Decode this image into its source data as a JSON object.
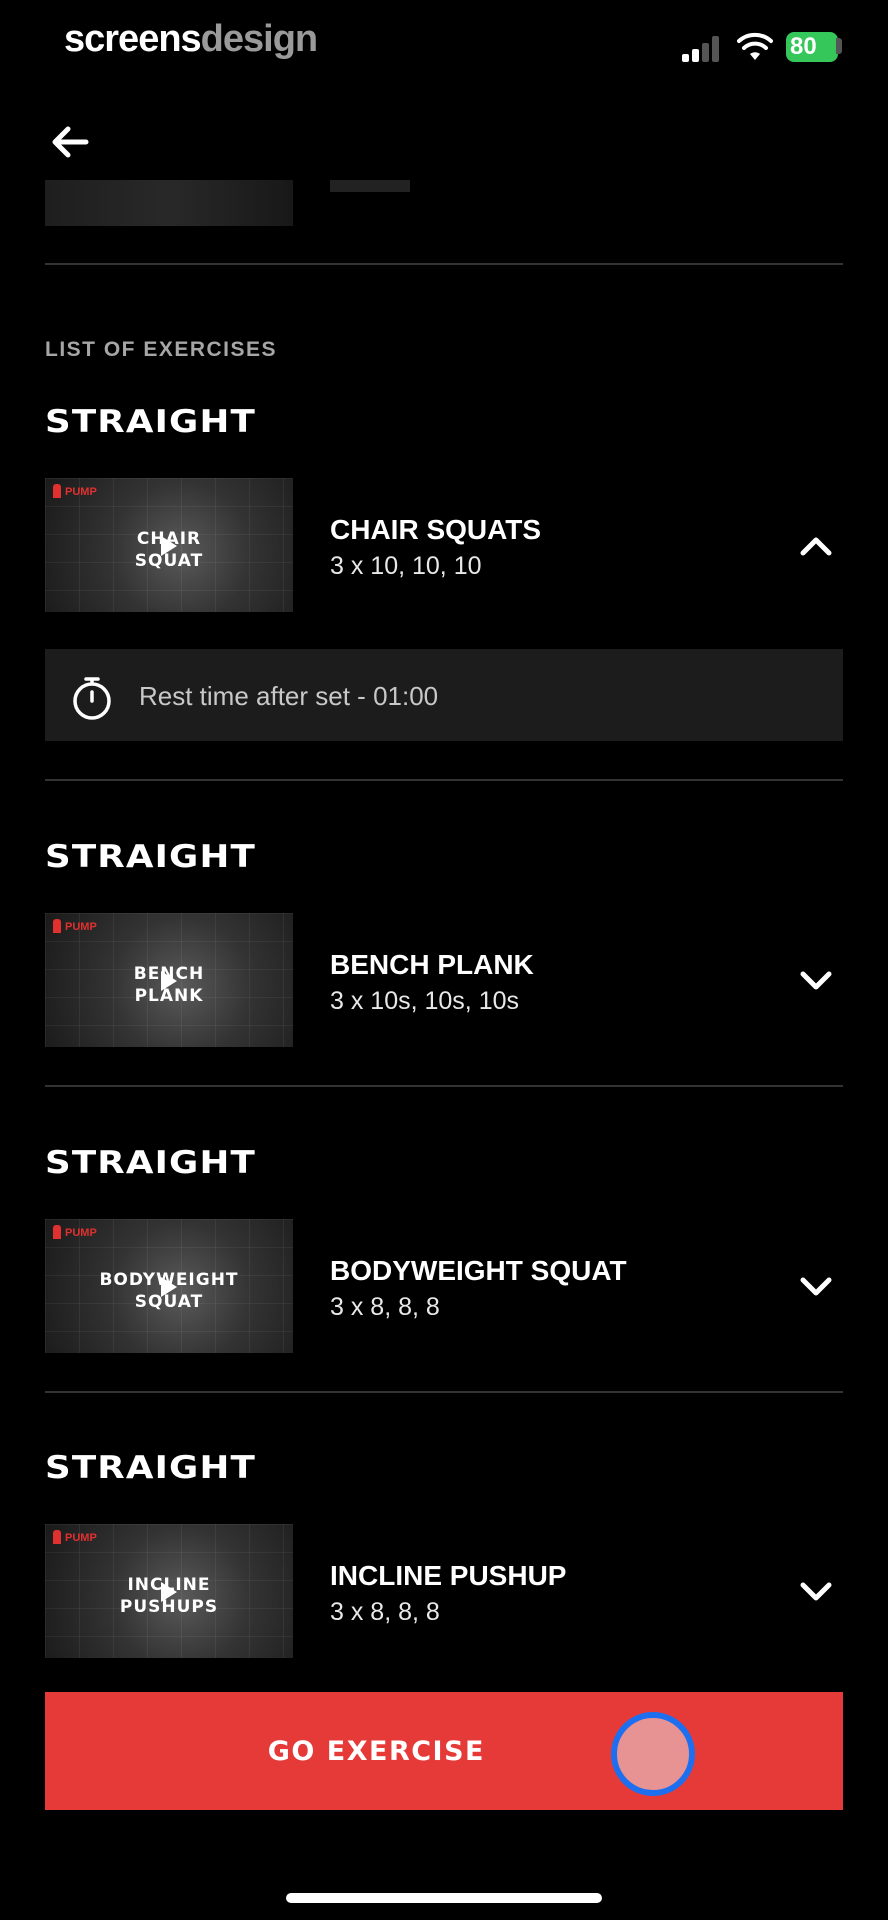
{
  "status_bar": {
    "brand_part1": "screens",
    "brand_part2": "design",
    "battery": "80"
  },
  "section_label": "LIST OF EXERCISES",
  "exercises": [
    {
      "group": "STRAIGHT",
      "thumb_logo": "PUMP",
      "thumb_caption_line1": "CHAIR",
      "thumb_caption_line2": "SQUAT",
      "name": "CHAIR SQUATS",
      "sets": "3 x 10, 10, 10",
      "expanded": true,
      "rest_text": "Rest time after set - 01:00"
    },
    {
      "group": "STRAIGHT",
      "thumb_logo": "PUMP",
      "thumb_caption_line1": "BENCH",
      "thumb_caption_line2": "PLANK",
      "name": "BENCH PLANK",
      "sets": "3 x 10s, 10s, 10s",
      "expanded": false
    },
    {
      "group": "STRAIGHT",
      "thumb_logo": "PUMP",
      "thumb_caption_line1": "BODYWEIGHT",
      "thumb_caption_line2": "SQUAT",
      "name": "BODYWEIGHT SQUAT",
      "sets": "3 x 8, 8, 8",
      "expanded": false
    },
    {
      "group": "STRAIGHT",
      "thumb_logo": "PUMP",
      "thumb_caption_line1": "INCLINE",
      "thumb_caption_line2": "PUSHUPS",
      "name": "INCLINE PUSHUP",
      "sets": "3 x 8, 8, 8",
      "expanded": false
    }
  ],
  "go_button_label": "GO EXERCISE",
  "colors": {
    "accent": "#e53a38",
    "battery": "#35c759",
    "touch_ring": "#1e6ff0"
  }
}
